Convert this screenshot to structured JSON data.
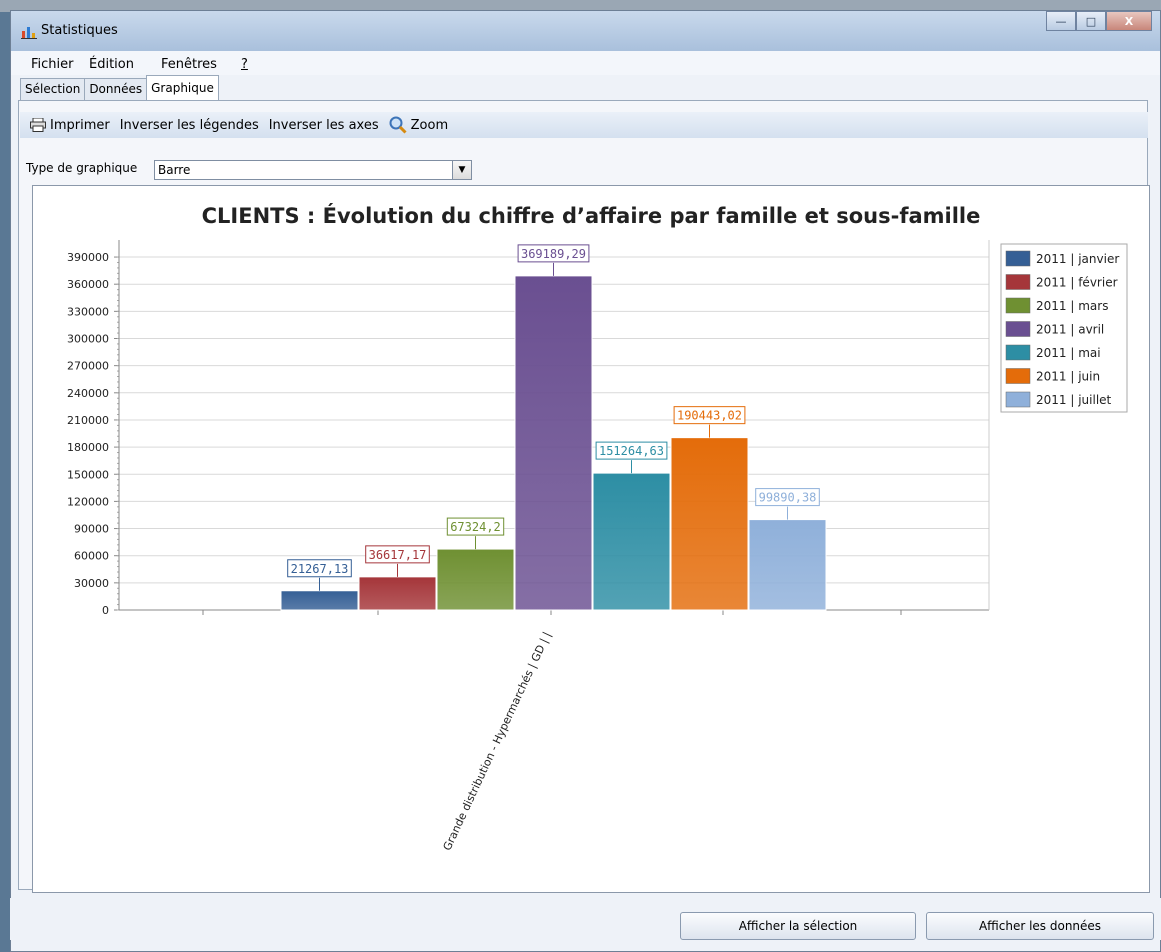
{
  "window": {
    "title": "Statistiques"
  },
  "window_buttons": {
    "minimize": "—",
    "maximize": "□",
    "close": "X"
  },
  "menu": {
    "file": "Fichier",
    "edit": "Édition",
    "windows": "Fenêtres",
    "help": "?"
  },
  "tabs": [
    "Sélection",
    "Données",
    "Graphique"
  ],
  "toolbar": {
    "print": "Imprimer",
    "invert_legends": "Inverser les légendes",
    "invert_axes": "Inverser les axes",
    "zoom": "Zoom"
  },
  "chart_type": {
    "label": "Type de graphique",
    "value": "Barre"
  },
  "chart_data": {
    "type": "bar",
    "title": "CLIENTS : Évolution du chiffre d’affaire par famille et sous-famille",
    "categories": [
      "Grande distribution - Hypermarchés | GD |  |"
    ],
    "series": [
      {
        "name": "2011 | janvier",
        "values": [
          21267.13
        ],
        "label": "21267,13",
        "color": "#355f95"
      },
      {
        "name": "2011 | février",
        "values": [
          36617.17
        ],
        "label": "36617,17",
        "color": "#a5363a"
      },
      {
        "name": "2011 | mars",
        "values": [
          67324.2
        ],
        "label": "67324,2",
        "color": "#6f9032"
      },
      {
        "name": "2011 | avril",
        "values": [
          369189.29
        ],
        "label": "369189,29",
        "color": "#6a4f91"
      },
      {
        "name": "2011 | mai",
        "values": [
          151264.63
        ],
        "label": "151264,63",
        "color": "#2d8ea4"
      },
      {
        "name": "2011 | juin",
        "values": [
          190443.02
        ],
        "label": "190443,02",
        "color": "#e46c0a"
      },
      {
        "name": "2011 | juillet",
        "values": [
          99890.38
        ],
        "label": "99890,38",
        "color": "#8fb0da"
      }
    ],
    "yticks": [
      "390000",
      "360000",
      "330000",
      "300000",
      "270000",
      "240000",
      "210000",
      "180000",
      "150000",
      "120000",
      "90000",
      "60000",
      "30000",
      "0"
    ],
    "ylim": [
      0,
      400000
    ],
    "grid": true,
    "legend": "right"
  },
  "buttons": {
    "show_selection": "Afficher la sélection",
    "show_data": "Afficher les données"
  }
}
